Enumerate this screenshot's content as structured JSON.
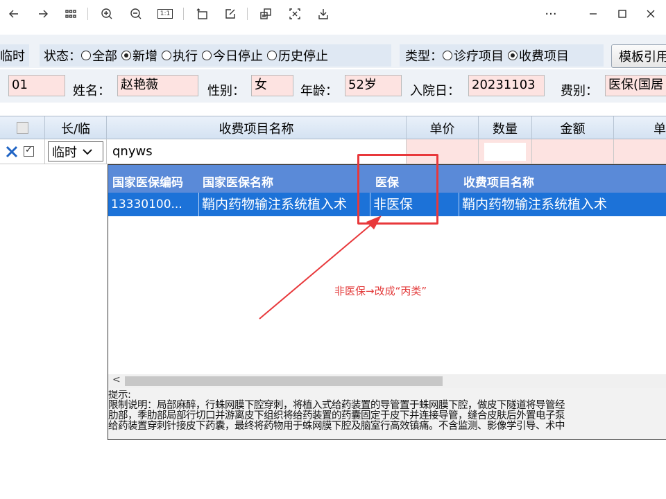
{
  "viewer": {
    "icons": [
      "back-arrow-icon",
      "forward-arrow-icon",
      "grid-icon",
      "zoom-in-icon",
      "zoom-out-icon",
      "actual-size-icon",
      "rotate-icon",
      "edit-icon",
      "extract-text-icon",
      "translate-icon",
      "download-icon",
      "more-icon",
      "minimize-icon",
      "maximize-icon",
      "close-icon"
    ],
    "actual_size_label": "1:1",
    "more_label": "···"
  },
  "filter": {
    "left_label": "临时",
    "status_label": "状态：",
    "status_options": [
      "全部",
      "新增",
      "执行",
      "今日停止",
      "历史停止"
    ],
    "status_selected": "新增",
    "type_label": "类型：",
    "type_options": [
      "诊疗项目",
      "收费项目"
    ],
    "type_selected": "收费项目",
    "template_button": "模板引用"
  },
  "patient": {
    "id_value": "01",
    "name_label": "姓名：",
    "name_value": "赵艳薇",
    "gender_label": "性别：",
    "gender_value": "女",
    "age_label": "年龄：",
    "age_value": "52岁",
    "admit_label": "入院日：",
    "admit_value": "20231103",
    "fee_label": "费别：",
    "fee_value": "医保(国居"
  },
  "grid": {
    "headers": [
      "",
      "长/临",
      "收费项目名称",
      "单价",
      "数量",
      "金额",
      "单"
    ],
    "row": {
      "type_value": "临时",
      "name_input": "qnyws",
      "qty_value": ""
    }
  },
  "popup": {
    "headers": [
      "国家医保编码",
      "国家医保名称",
      "医保",
      "收费项目名称"
    ],
    "row": {
      "code": "13330100...",
      "national_name": "鞘内药物输注系统植入术",
      "insurance": "非医保",
      "item_name": "鞘内药物输注系统植入术"
    },
    "tips_title": "提示:",
    "tips_lines": [
      "限制说明：局部麻醉，行蛛网膜下腔穿刺，将植入式给药装置的导管置于蛛网膜下腔，做皮下隧道将导管经",
      "肋部，季肋部局部行切口并游离皮下组织将给药装置的药囊固定于皮下并连接导管，缝合皮肤后外置电子泵",
      "给药装置穿刺针接皮下药囊，最终将药物用于蛛网膜下腔及脑室行高效镇痛。不含监测、影像学引导、术中"
    ]
  },
  "annotation": {
    "text": "非医保→改成“丙类”",
    "color": "#e33c3c"
  }
}
